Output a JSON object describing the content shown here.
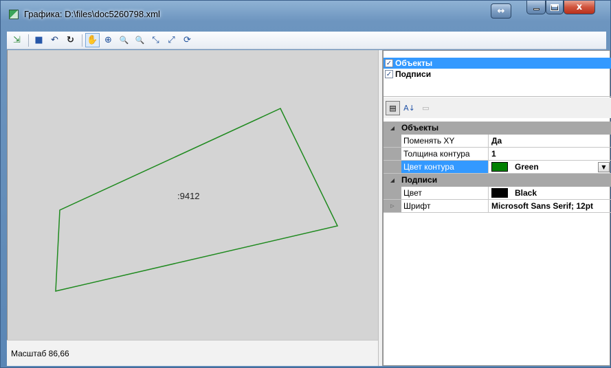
{
  "window": {
    "title": "Графика: D:\\files\\doc5260798.xml",
    "extra_button_glyph": "↔",
    "close_glyph": "x"
  },
  "toolbar": {
    "buttons": [
      {
        "name": "export-icon",
        "glyph": "⇲"
      },
      {
        "name": "save-icon",
        "glyph": "■"
      },
      {
        "name": "undo-icon",
        "glyph": "↶"
      },
      {
        "name": "redo-icon",
        "glyph": "↻"
      },
      {
        "name": "pan-hand-icon",
        "glyph": "✋"
      },
      {
        "name": "center-icon",
        "glyph": "⊕"
      },
      {
        "name": "zoom-in-icon",
        "glyph": "🔍"
      },
      {
        "name": "zoom-out-icon",
        "glyph": "🔍"
      },
      {
        "name": "collapse-icon",
        "glyph": "⤡"
      },
      {
        "name": "expand-icon",
        "glyph": "⤢"
      },
      {
        "name": "refresh-icon",
        "glyph": "⟳"
      }
    ]
  },
  "canvas": {
    "parcel_label": ":9412",
    "outline_color": "#1f8a1f",
    "background": "#d4d4d4"
  },
  "status": {
    "scale_text": "Масштаб  86,66"
  },
  "layers": [
    {
      "label": "Объекты",
      "checked": true,
      "selected": true
    },
    {
      "label": "Подписи",
      "checked": true,
      "selected": false
    }
  ],
  "property_toolbar": {
    "categorized_glyph": "▤",
    "alphabetical_glyph": "A↓",
    "pages_glyph": "▭"
  },
  "property_grid": {
    "categories": [
      {
        "name": "Объекты",
        "toggle": "◢",
        "properties": [
          {
            "name": "Поменять XY",
            "value": "Да"
          },
          {
            "name": "Толщина контура",
            "value": "1"
          },
          {
            "name": "Цвет контура",
            "value": "Green",
            "swatch": "#008000",
            "selected": true,
            "dropdown": "▼"
          }
        ]
      },
      {
        "name": "Подписи",
        "toggle": "◢",
        "properties": [
          {
            "name": "Цвет",
            "value": "Black",
            "swatch": "#000000"
          },
          {
            "name": "Шрифт",
            "value": "Microsoft Sans Serif; 12pt",
            "expander": "▷"
          }
        ]
      }
    ]
  }
}
